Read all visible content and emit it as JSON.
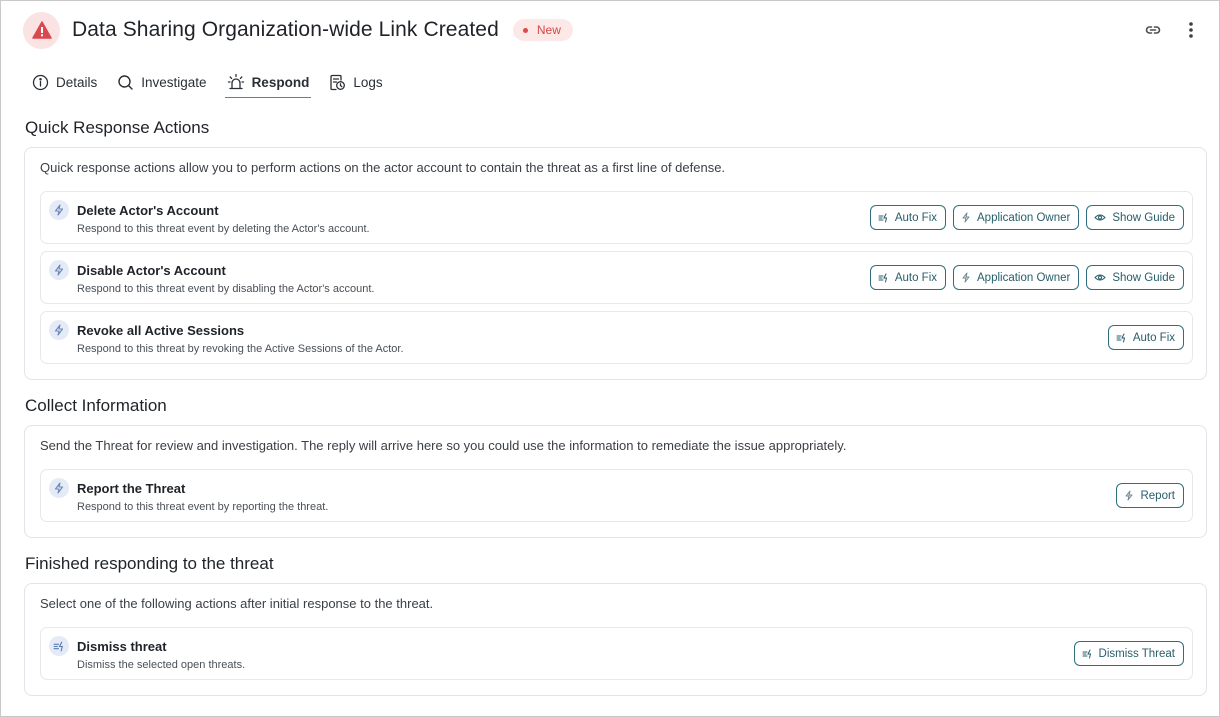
{
  "header": {
    "title": "Data Sharing Organization-wide Link Created",
    "badge": "New",
    "icons": {
      "alert": "warning-triangle-icon",
      "link": "link-icon",
      "more": "more-vertical-icon"
    }
  },
  "tabs": [
    {
      "label": "Details",
      "icon": "info-icon",
      "active": false
    },
    {
      "label": "Investigate",
      "icon": "search-icon",
      "active": false
    },
    {
      "label": "Respond",
      "icon": "siren-icon",
      "active": true
    },
    {
      "label": "Logs",
      "icon": "logs-icon",
      "active": false
    }
  ],
  "quick": {
    "title": "Quick Response Actions",
    "desc": "Quick response actions allow you to perform actions on the actor account to contain the threat as a first line of defense.",
    "rows": [
      {
        "title": "Delete Actor's Account",
        "sub": "Respond to this threat event by deleting the Actor's account.",
        "buttons": [
          "Auto Fix",
          "Application Owner",
          "Show Guide"
        ]
      },
      {
        "title": "Disable Actor's Account",
        "sub": "Respond to this threat event by disabling the Actor's account.",
        "buttons": [
          "Auto Fix",
          "Application Owner",
          "Show Guide"
        ]
      },
      {
        "title": "Revoke all Active Sessions",
        "sub": "Respond to this threat by revoking the Active Sessions of the Actor.",
        "buttons": [
          "Auto Fix"
        ]
      }
    ]
  },
  "collect": {
    "title": "Collect Information",
    "desc": "Send the Threat for review and investigation. The reply will arrive here so you could use the information to remediate the issue appropriately.",
    "rows": [
      {
        "title": "Report the Threat",
        "sub": "Respond to this threat event by reporting the threat.",
        "buttons": [
          "Report"
        ]
      }
    ]
  },
  "finished": {
    "title": "Finished responding to the threat",
    "desc": "Select one of the following actions after initial response to the threat.",
    "rows": [
      {
        "title": "Dismiss threat",
        "sub": "Dismiss the selected open threats.",
        "buttons": [
          "Dismiss Threat"
        ]
      }
    ]
  },
  "colors": {
    "accent": "#285e6b",
    "danger": "#d64545",
    "tab_underline": "#c2566d",
    "icon_bg": "#e4ebf7"
  }
}
